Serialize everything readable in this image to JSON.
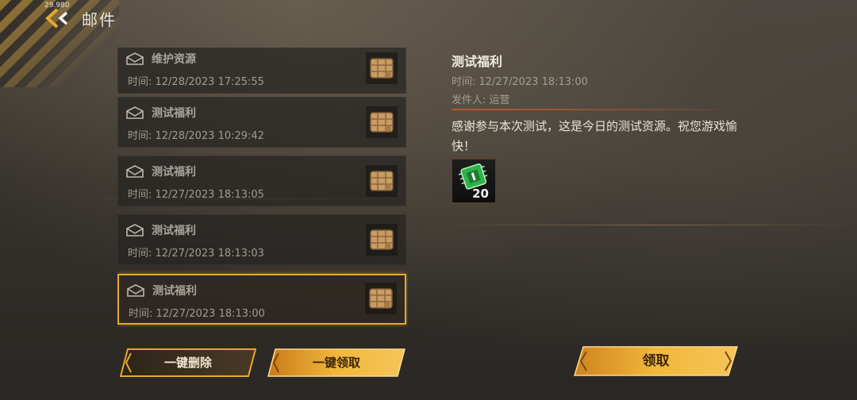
{
  "status": {
    "fps": "29.980"
  },
  "header": {
    "title": "邮件"
  },
  "mails": [
    {
      "subject": "维护资源",
      "time": "时间: 12/28/2023 17:25:55"
    },
    {
      "subject": "测试福利",
      "time": "时间: 12/28/2023 10:29:42"
    },
    {
      "subject": "测试福利",
      "time": "时间: 12/27/2023 18:13:05"
    },
    {
      "subject": "测试福利",
      "time": "时间: 12/27/2023 18:13:03"
    },
    {
      "subject": "测试福利",
      "time": "时间: 12/27/2023 18:13:00",
      "selected": true
    }
  ],
  "detail": {
    "title": "测试福利",
    "time": "时间: 12/27/2023 18:13:00",
    "sender": "发件人: 运营",
    "body": "感谢参与本次测试，这是今日的测试资源。祝您游戏愉快！",
    "attachment": {
      "icon": "green-chip-icon",
      "count": "20"
    }
  },
  "buttons": {
    "delete_all": "一键删除",
    "claim_all": "一键领取",
    "claim": "领取"
  },
  "colors": {
    "accent": "#e7a92a",
    "button_gold": "#f1b73b",
    "button_dark": "#4a3a25"
  }
}
